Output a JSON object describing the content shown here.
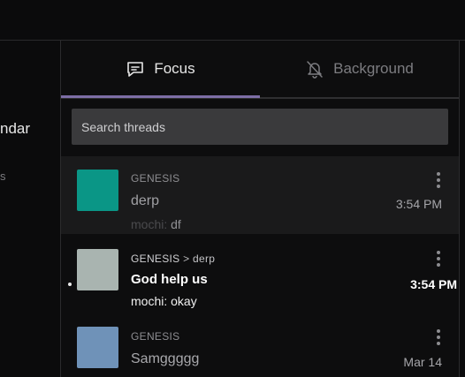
{
  "sidebar": {
    "calendar_label": "ndar",
    "secondary": "s"
  },
  "tabs": [
    {
      "label": "Focus",
      "icon": "chat-bubble-icon",
      "active": true
    },
    {
      "label": "Background",
      "icon": "bell-off-icon",
      "active": false
    }
  ],
  "search": {
    "placeholder": "Search threads"
  },
  "threads": [
    {
      "server": "GENESIS",
      "channel": "",
      "title": "derp",
      "author": "mochi:",
      "preview": "df",
      "time": "3:54 PM",
      "color": "#0a9686",
      "selected": true,
      "unread": false
    },
    {
      "server": "GENESIS",
      "channel": "derp",
      "title": "God help us",
      "author": "mochi:",
      "preview": "okay",
      "time": "3:54 PM",
      "color": "#a9b4b0",
      "selected": false,
      "unread": true
    },
    {
      "server": "GENESIS",
      "channel": "",
      "title": "Samggggg",
      "author": "",
      "preview": "",
      "time": "Mar 14",
      "color": "#6f92b8",
      "selected": false,
      "unread": false
    }
  ],
  "colors": {
    "accent": "#7d6ea6",
    "background": "#0b0b0c",
    "panel": "#0d0d0e",
    "selected_row": "#1a1a1b"
  }
}
